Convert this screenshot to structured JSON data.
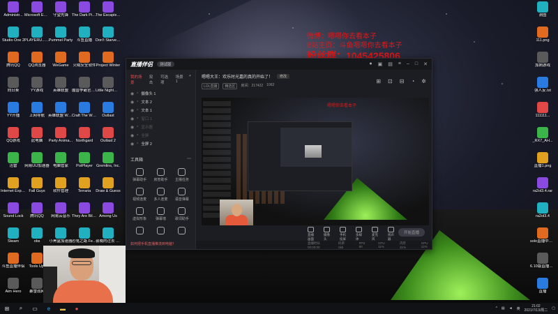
{
  "desktop": {
    "col1": [
      "Administr...",
      "Studio One 2",
      "腾讯QQ",
      "向日葵",
      "YY开播",
      "QQ游戏",
      "迅雷",
      "Internet Explorer",
      "Sound Lock",
      "Steam",
      "斗鱼直播伴侣",
      "Aim Hero"
    ],
    "col2": [
      "Microsoft Edge",
      "PLAYERU... BATTLEGR...",
      "QQ浏览器",
      "YY游戏",
      "上网导航",
      "此电脑",
      "网易UU加速器",
      "Fall Guys",
      "腾讯QQ",
      "obs",
      "Tools Upt",
      "暴雪战网"
    ],
    "col3": [
      "守望先锋",
      "Pummel Party",
      "WeGame",
      "英雄联盟",
      "英雄联盟 WeGame版",
      "Party Anima...",
      "电脑管家",
      "软件管理",
      "网易云音乐",
      "小黑盒加速器",
      "",
      "",
      ""
    ],
    "col4": [
      "The Dark Pictures ...",
      "斗鱼直播",
      "火绒安全软件",
      "魔兽争霸官方对战平台",
      "Craft The World",
      "Northgard",
      "PotPlayer",
      "Terraria",
      "They Are Billions",
      "恐鬼之路 Fear sur..."
    ],
    "col5": [
      "The Escapists 2",
      "Don't Starve Together",
      "Project Winter",
      "Little Nightmares",
      "Outlast",
      "Outlast 2",
      "Gremlins, Inc.",
      "Draw & Guess",
      "Among Us",
      "夜晚的过去 游戏乱码解..."
    ],
    "right": [
      "测图",
      "111.png",
      "加刚游戏",
      "强人反.txt",
      "111111...",
      "_RX7_AH...",
      "直播1.png",
      "ra2ol3.4.rar",
      "ra2ol3.4",
      "solo直播中装度.txt",
      "6.10版直播内容",
      "直播",
      "观看1.mp4"
    ]
  },
  "overlay": {
    "line1": "微博：嗯嗯你去看本子",
    "line2": "B站主页：斗鱼嗯嗯你去看本子",
    "line3": "粉丝群：1045425806"
  },
  "app": {
    "logo": "直播伴侣",
    "version": "测试版",
    "scene_tabs": [
      "我的场景",
      "双击",
      "可选项",
      "场景1",
      "+"
    ],
    "sources": [
      {
        "name": "摄像头 1",
        "dim": false
      },
      {
        "name": "文本 2",
        "dim": false
      },
      {
        "name": "文本 1",
        "dim": false
      },
      {
        "name": "窗口 1",
        "dim": true
      },
      {
        "name": "显示器",
        "dim": true
      },
      {
        "name": "全屏",
        "dim": true
      },
      {
        "name": "全屏 2",
        "dim": false
      }
    ],
    "toolbox_label": "工具箱",
    "tools": [
      "弹幕助手",
      "房管助手",
      "主播任务",
      "视频连麦",
      "多人连麦",
      "语音弹幕",
      "虚拟形象",
      "弹幕墙",
      "歌词助手",
      "",
      "",
      ""
    ],
    "notice": "如何把手机直播推流到电脑？",
    "room_title": "嗯嗯大王：欢乐时光嘉的真的开始了！",
    "room_edit": "修改",
    "room_category": "LOL直播",
    "room_tag": "精选区",
    "room_id": "房间：217422",
    "room_fans": "1062",
    "preview_red": "嗯嗯你去看本子",
    "controls": [
      "直播画面",
      "摄像头",
      "手机投屏",
      "多媒体",
      "麦克风",
      "扬声器"
    ],
    "start_button": "开始直播",
    "status": [
      "直播时长 00:00:00",
      "码率 0kb",
      "FPS 60",
      "CPU 11%",
      "内存 31%",
      "GPU 12%"
    ]
  },
  "taskbar": {
    "time": "21:02",
    "date": "2021/7/13/周二",
    "lang": "英"
  }
}
